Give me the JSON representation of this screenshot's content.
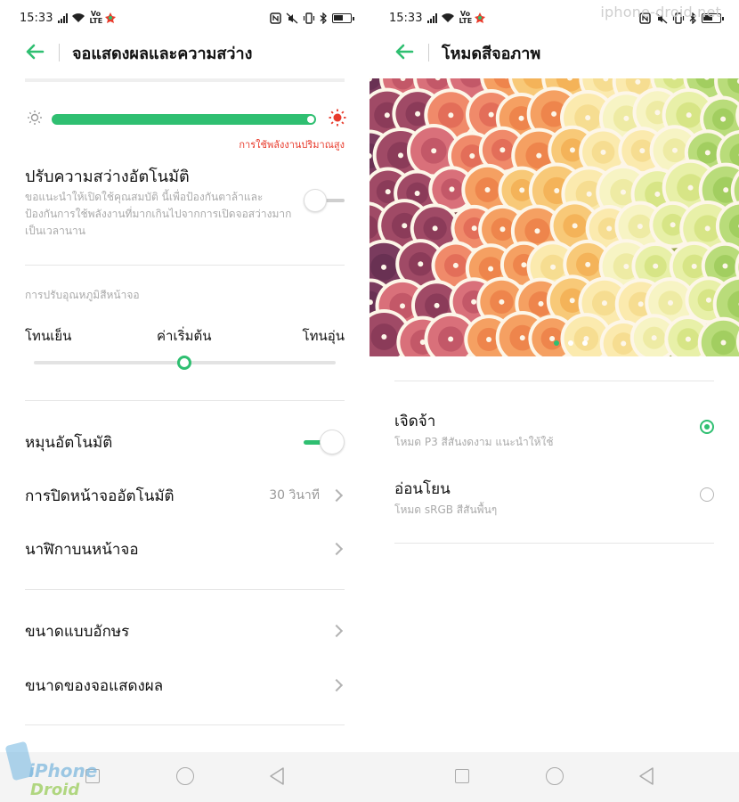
{
  "left": {
    "status": {
      "time": "15:33",
      "volte": "Vo LTE"
    },
    "header": {
      "back_icon": "arrow-left-icon",
      "title": "จอแสดงผลและความสว่าง"
    },
    "brightness": {
      "level_fraction": 1.0,
      "warning": "การใช้พลังงานปริมาณสูง"
    },
    "auto_brightness": {
      "title": "ปรับความสว่างอัตโนมัติ",
      "description": "ขอแนะนำให้เปิดใช้คุณสมบัติ นี้เพื่อป้องกันตาล้าและป้องกันการใช้พลังงานที่มากเกินไปจากการเปิดจอสว่างมากเป็นเวลานาน",
      "enabled": false
    },
    "color_temp": {
      "section_label": "การปรับอุณหภูมิสีหน้าจอ",
      "cool_label": "โทนเย็น",
      "default_label": "ค่าเริ่มต้น",
      "warm_label": "โทนอุ่น",
      "level_fraction": 0.5
    },
    "rows": {
      "auto_rotate": {
        "label": "หมุนอัตโนมัติ",
        "enabled": true
      },
      "screen_timeout": {
        "label": "การปิดหน้าจออัตโนมัติ",
        "value": "30 วินาที"
      },
      "clock": {
        "label": "นาฬิกาบนหน้าจอ"
      },
      "font_size": {
        "label": "ขนาดแบบอักษร"
      },
      "display_size": {
        "label": "ขนาดของจอแสดงผล"
      }
    },
    "watermark": {
      "line1": "iPhone",
      "line2": "Droid"
    }
  },
  "right": {
    "status": {
      "time": "15:33",
      "volte": "Vo LTE"
    },
    "watermark_text": "iphone-droid.net",
    "header": {
      "back_icon": "arrow-left-icon",
      "title": "โหมดสีจอภาพ"
    },
    "preview": {
      "image": "citrus-slices-photo",
      "page_count": 3,
      "active_page": 1
    },
    "modes": [
      {
        "name": "เจิดจ้า",
        "description": "โหมด P3 สีสันงดงาม แนะนำให้ใช้",
        "selected": true
      },
      {
        "name": "อ่อนโยน",
        "description": "โหมด sRGB สีสันพื้นๆ",
        "selected": false
      }
    ]
  },
  "colors": {
    "accent": "#2fbf71",
    "warning": "#e83b2c"
  }
}
